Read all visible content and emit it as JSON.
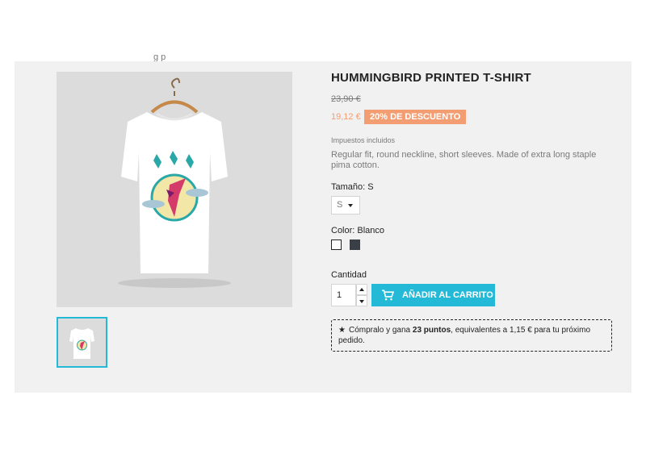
{
  "breadcrumb": {
    "partial_text": "g p"
  },
  "gallery": {
    "main_image": {
      "description": "white t-shirt with hummingbird print on hanger"
    },
    "thumbnail_selected": true
  },
  "product": {
    "title": "HUMMINGBIRD PRINTED T-SHIRT",
    "regular_price": "23,90 €",
    "current_price": "19,12 €",
    "discount_badge": "20% DE DESCUENTO",
    "tax_label": "Impuestos incluidos",
    "description": "Regular fit, round neckline, short sleeves. Made of extra long staple pima cotton."
  },
  "variants": {
    "size_label": "Tamaño: S",
    "size_selected": "S",
    "color_label": "Color: Blanco",
    "colors": [
      "#ffffff",
      "#3a3f47"
    ]
  },
  "quantity": {
    "label": "Cantidad",
    "value": "1"
  },
  "cart": {
    "add_label": "AÑADIR AL CARRITO"
  },
  "loyalty": {
    "prefix": "Cómpralo y gana ",
    "points": "23 puntos",
    "suffix": ", equivalentes a 1,15 € para tu próximo pedido."
  },
  "colors": {
    "accent": "#24b9d7",
    "discount": "#f39d72",
    "panel_bg": "#f1f1f1"
  }
}
